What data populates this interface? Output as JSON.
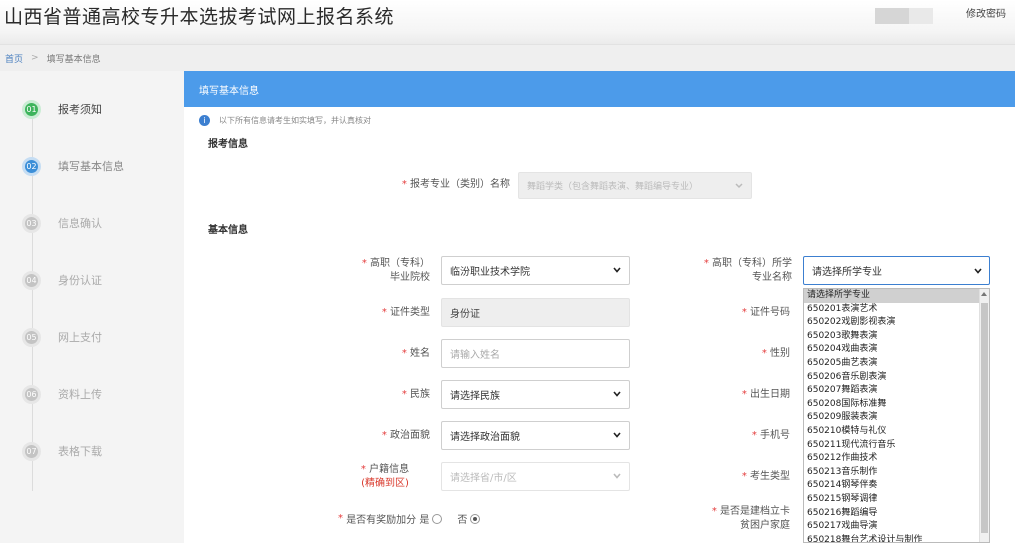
{
  "app": {
    "title": "山西省普通高校专升本选拔考试网上报名系统",
    "change_password": "修改密码"
  },
  "breadcrumb": [
    "首页",
    "填写基本信息"
  ],
  "steps": [
    {
      "num": "01",
      "label": "报考须知",
      "state": "done"
    },
    {
      "num": "02",
      "label": "填写基本信息",
      "state": "active"
    },
    {
      "num": "03",
      "label": "信息确认",
      "state": "pending"
    },
    {
      "num": "04",
      "label": "身份认证",
      "state": "pending"
    },
    {
      "num": "05",
      "label": "网上支付",
      "state": "pending"
    },
    {
      "num": "06",
      "label": "资料上传",
      "state": "pending"
    },
    {
      "num": "07",
      "label": "表格下载",
      "state": "pending"
    }
  ],
  "form": {
    "header": "填写基本信息",
    "notice": "以下所有信息请考生如实填写，并认真核对",
    "section_exam": "报考信息",
    "section_basic": "基本信息",
    "major_category_label": "报考专业（类别）名称",
    "major_category_value": "舞蹈学类（包含舞蹈表演、舞蹈编导专业）",
    "college_label_1": "高职（专科）",
    "college_label_2": "毕业院校",
    "college_value": "临汾职业技术学院",
    "major_label_1": "高职（专科）所学",
    "major_label_2": "专业名称",
    "major_value": "请选择所学专业",
    "id_type_label": "证件类型",
    "id_type_value": "身份证",
    "id_number_label": "证件号码",
    "name_label": "姓名",
    "name_placeholder": "请输入姓名",
    "gender_label": "性别",
    "ethnicity_label": "民族",
    "ethnicity_value": "请选择民族",
    "birth_label": "出生日期",
    "political_label": "政治面貌",
    "political_value": "请选择政治面貌",
    "phone_label": "手机号",
    "hukou_label": "户籍信息",
    "hukou_note": "(精确到区)",
    "hukou_value": "请选择省/市/区",
    "candidate_type_label": "考生类型",
    "bonus_label": "是否有奖励加分",
    "yes_label": "是",
    "no_label": "否",
    "bonus_selected": "否",
    "poverty_label_1": "是否是建档立卡",
    "poverty_label_2": "贫困户家庭",
    "required_mark": "*"
  },
  "major_options": [
    "请选择所学专业",
    "650201表演艺术",
    "650202戏剧影视表演",
    "650203歌舞表演",
    "650204戏曲表演",
    "650205曲艺表演",
    "650206音乐剧表演",
    "650207舞蹈表演",
    "650208国际标准舞",
    "650209服装表演",
    "650210模特与礼仪",
    "650211现代流行音乐",
    "650212作曲技术",
    "650213音乐制作",
    "650214钢琴伴奏",
    "650215钢琴调律",
    "650216舞蹈编导",
    "650217戏曲导演",
    "650218舞台艺术设计与制作"
  ],
  "colors": {
    "header_blue": "#4c9bea",
    "step_done": "#3db45c",
    "step_active": "#3c8fd8",
    "required_red": "#e43c3c"
  }
}
